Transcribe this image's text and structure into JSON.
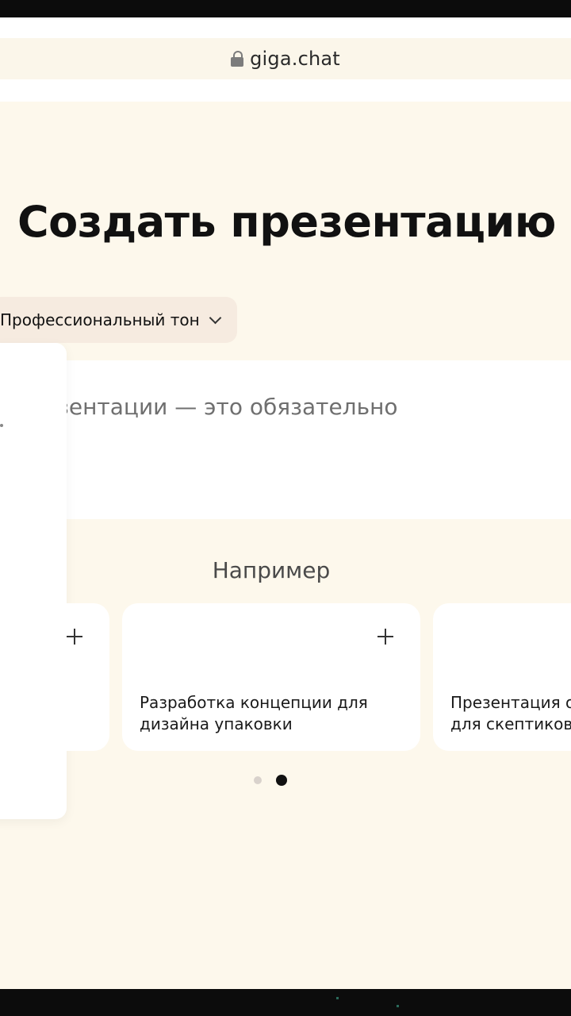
{
  "browser": {
    "url": "giga.chat"
  },
  "page": {
    "title": "Создать презентацию",
    "tone_selector": {
      "label": "Профессиональный тон"
    },
    "prompt": {
      "visible_text": "зентации — это обязательно"
    },
    "examples": {
      "heading": "Например",
      "cards": [
        {
          "title": ""
        },
        {
          "title": "Разработка концепции для\nдизайна упаковки"
        },
        {
          "title": "Презентация о\nдля скептиков"
        }
      ]
    },
    "pager": {
      "count": 2,
      "active_index": 1
    }
  }
}
